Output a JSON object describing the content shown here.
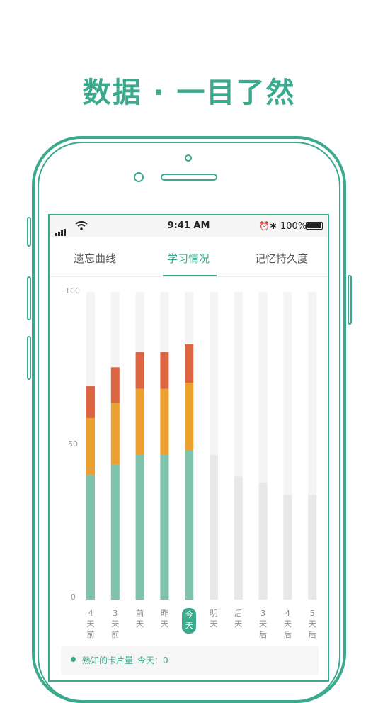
{
  "headline": "数据 · 一目了然",
  "status": {
    "time": "9:41 AM",
    "battery": "100%",
    "wifi_icon": "wifi-icon",
    "alarm_icon": "alarm-icon",
    "bluetooth_icon": "bluetooth-icon"
  },
  "tabs": [
    {
      "label": "遗忘曲线"
    },
    {
      "label": "学习情况"
    },
    {
      "label": "记忆持久度"
    }
  ],
  "active_tab": "学习情况",
  "colors": {
    "accent": "#3aa98d",
    "known": "#7fc3ad",
    "learning": "#eba030",
    "hard": "#dc6440",
    "forecast": "#e8e8e8",
    "track": "#f4f4f4"
  },
  "chart_data": {
    "type": "bar",
    "stacked": true,
    "ylim": [
      0,
      100
    ],
    "yticks": [
      "100",
      "50",
      "0"
    ],
    "categories": [
      "4天前",
      "3天前",
      "前天",
      "昨天",
      "今天",
      "明天",
      "后天",
      "3天后",
      "4天后",
      "5天后"
    ],
    "category_chars": [
      [
        "4",
        "天",
        "前"
      ],
      [
        "3",
        "天",
        "前"
      ],
      [
        "前",
        "天"
      ],
      [
        "昨",
        "天"
      ],
      [
        "今",
        "天"
      ],
      [
        "明",
        "天"
      ],
      [
        "后",
        "天"
      ],
      [
        "3",
        "天",
        "后"
      ],
      [
        "4",
        "天",
        "后"
      ],
      [
        "5",
        "天",
        "后"
      ]
    ],
    "today_index": 4,
    "series": [
      {
        "values": [
          40.5,
          44,
          47,
          47,
          48.5,
          null,
          null,
          null,
          null,
          null
        ]
      },
      {
        "values": [
          18.5,
          20,
          21.5,
          21.5,
          22,
          null,
          null,
          null,
          null,
          null
        ]
      },
      {
        "values": [
          10.5,
          11.5,
          12,
          12,
          12.5,
          null,
          null,
          null,
          null,
          null
        ]
      }
    ],
    "forecast": [
      null,
      null,
      null,
      null,
      null,
      47,
      40,
      38,
      34,
      34
    ]
  },
  "legend": {
    "label": "熟知的卡片量",
    "today_text": "今天：0"
  }
}
